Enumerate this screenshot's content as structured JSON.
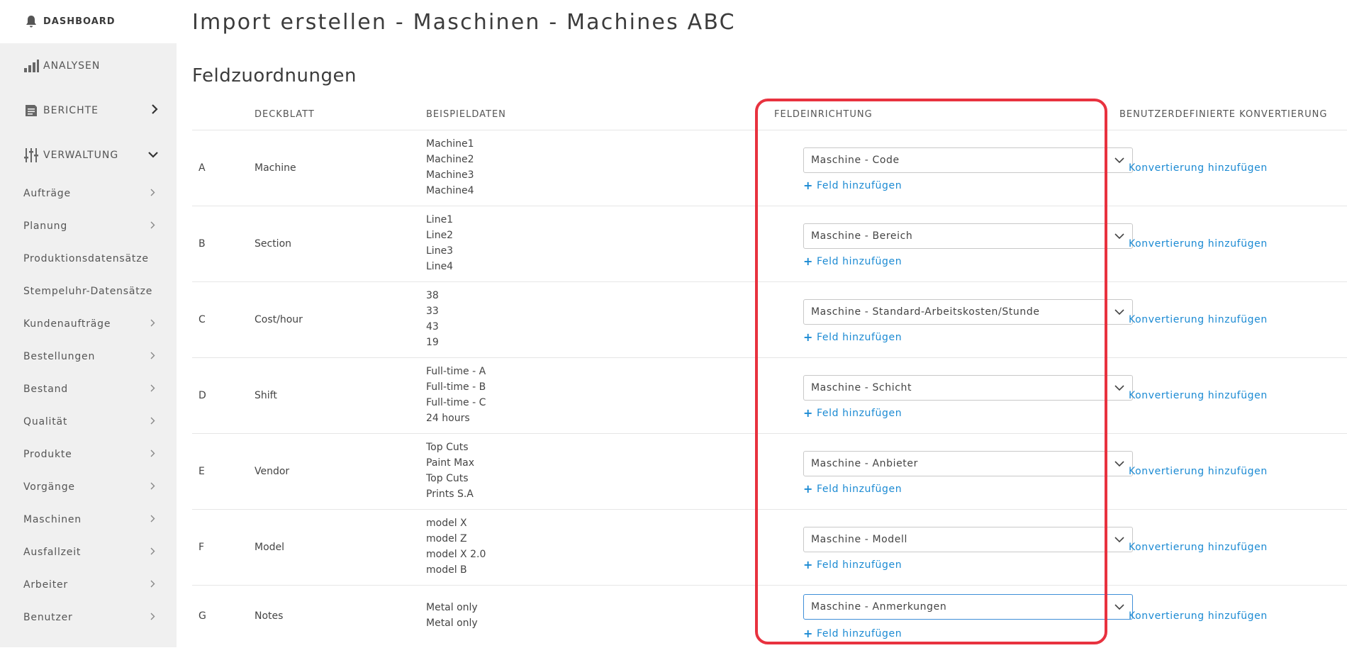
{
  "sidebar": {
    "dashboard": "DASHBOARD",
    "analysen": "ANALYSEN",
    "berichte": "BERICHTE",
    "verwaltung": "VERWALTUNG",
    "items": [
      {
        "label": "Aufträge",
        "chevron": true
      },
      {
        "label": "Planung",
        "chevron": true
      },
      {
        "label": "Produktionsdatensätze",
        "chevron": false
      },
      {
        "label": "Stempeluhr-Datensätze",
        "chevron": false
      },
      {
        "label": "Kundenaufträge",
        "chevron": true
      },
      {
        "label": "Bestellungen",
        "chevron": true
      },
      {
        "label": "Bestand",
        "chevron": true
      },
      {
        "label": "Qualität",
        "chevron": true
      },
      {
        "label": "Produkte",
        "chevron": true
      },
      {
        "label": "Vorgänge",
        "chevron": true
      },
      {
        "label": "Maschinen",
        "chevron": true
      },
      {
        "label": "Ausfallzeit",
        "chevron": true
      },
      {
        "label": "Arbeiter",
        "chevron": true
      },
      {
        "label": "Benutzer",
        "chevron": true
      }
    ]
  },
  "page": {
    "title": "Import erstellen - Maschinen - Machines ABC",
    "section": "Feldzuordnungen"
  },
  "table": {
    "headers": {
      "sheet": "DECKBLATT",
      "samples": "BEISPIELDATEN",
      "field": "FELDEINRICHTUNG",
      "conversion": "BENUTZERDEFINIERTE KONVERTIERUNG"
    },
    "add_field_label": "Feld hinzufügen",
    "conversion_label": "Konvertierung hinzufügen",
    "rows": [
      {
        "key": "A",
        "sheet": "Machine",
        "samples": [
          "Machine1",
          "Machine2",
          "Machine3",
          "Machine4"
        ],
        "field": "Maschine - Code"
      },
      {
        "key": "B",
        "sheet": "Section",
        "samples": [
          "Line1",
          "Line2",
          "Line3",
          "Line4"
        ],
        "field": "Maschine - Bereich"
      },
      {
        "key": "C",
        "sheet": "Cost/hour",
        "samples": [
          "38",
          "33",
          "43",
          "19"
        ],
        "field": "Maschine - Standard-Arbeitskosten/Stunde"
      },
      {
        "key": "D",
        "sheet": "Shift",
        "samples": [
          "Full-time - A",
          "Full-time - B",
          "Full-time - C",
          "24 hours"
        ],
        "field": "Maschine - Schicht"
      },
      {
        "key": "E",
        "sheet": "Vendor",
        "samples": [
          "Top Cuts",
          "Paint Max",
          "Top Cuts",
          "Prints S.A"
        ],
        "field": "Maschine - Anbieter"
      },
      {
        "key": "F",
        "sheet": "Model",
        "samples": [
          "model X",
          "model Z",
          "model X 2.0",
          "model B"
        ],
        "field": "Maschine - Modell"
      },
      {
        "key": "G",
        "sheet": "Notes",
        "samples": [
          "Metal only",
          "Metal only"
        ],
        "field": "Maschine - Anmerkungen"
      }
    ]
  },
  "colors": {
    "accent_link": "#1b8ad3",
    "highlight": "#e8323f",
    "sidebar_bg": "#f0f0f0"
  }
}
